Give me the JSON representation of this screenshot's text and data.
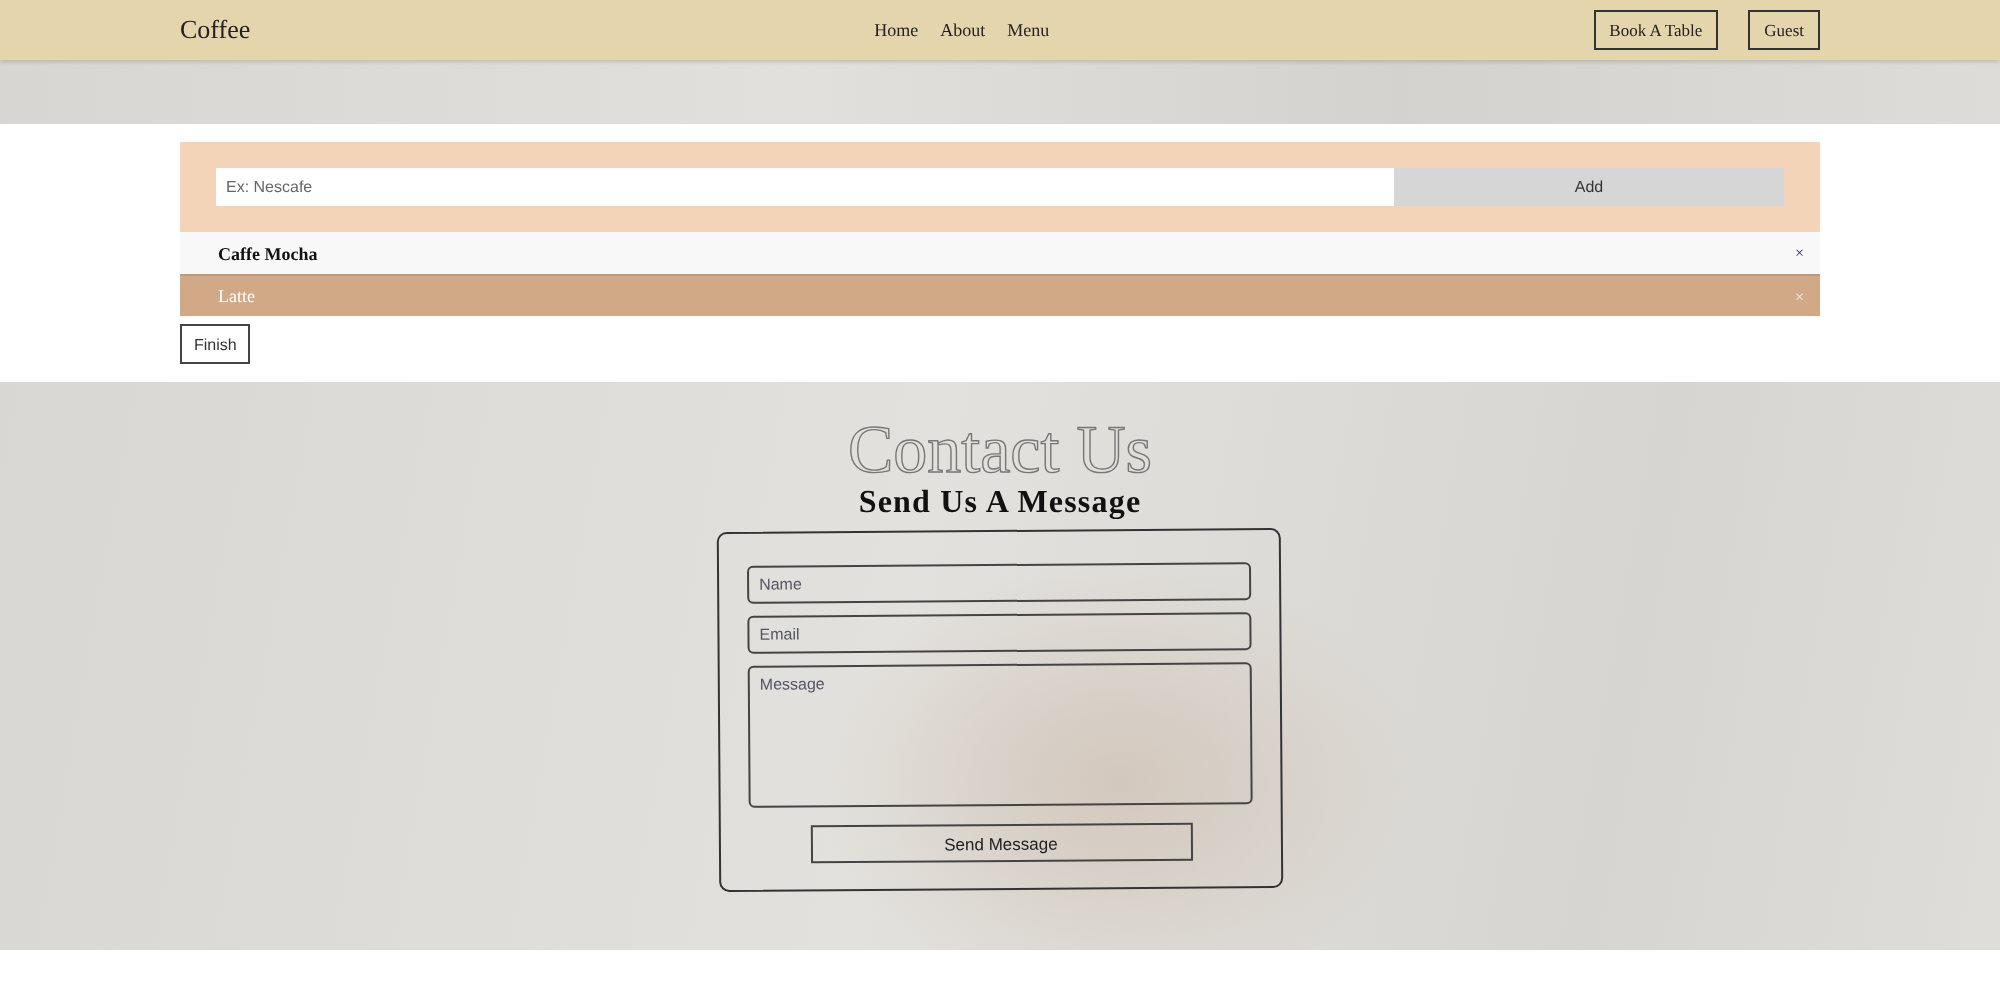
{
  "navbar": {
    "brand": "Coffee",
    "links": [
      {
        "label": "Home"
      },
      {
        "label": "About"
      },
      {
        "label": "Menu"
      }
    ],
    "buttons": [
      "Book A Table",
      "Guest"
    ]
  },
  "order": {
    "input": {
      "placeholder": "Ex: Nescafe"
    },
    "add_button": "Add",
    "items": [
      {
        "name": "Caffe Mocha",
        "selected": false,
        "remove": "×"
      },
      {
        "name": "Latte",
        "selected": true,
        "remove": "×"
      }
    ],
    "finish_button": "Finish"
  },
  "contact": {
    "backdrop_title": "Contact Us",
    "title": "Send Us A Message",
    "fields": [
      {
        "kind": "input",
        "placeholder": "Name"
      },
      {
        "kind": "input",
        "placeholder": "Email"
      },
      {
        "kind": "textarea",
        "placeholder": "Message"
      }
    ],
    "submit": "Send Message"
  }
}
